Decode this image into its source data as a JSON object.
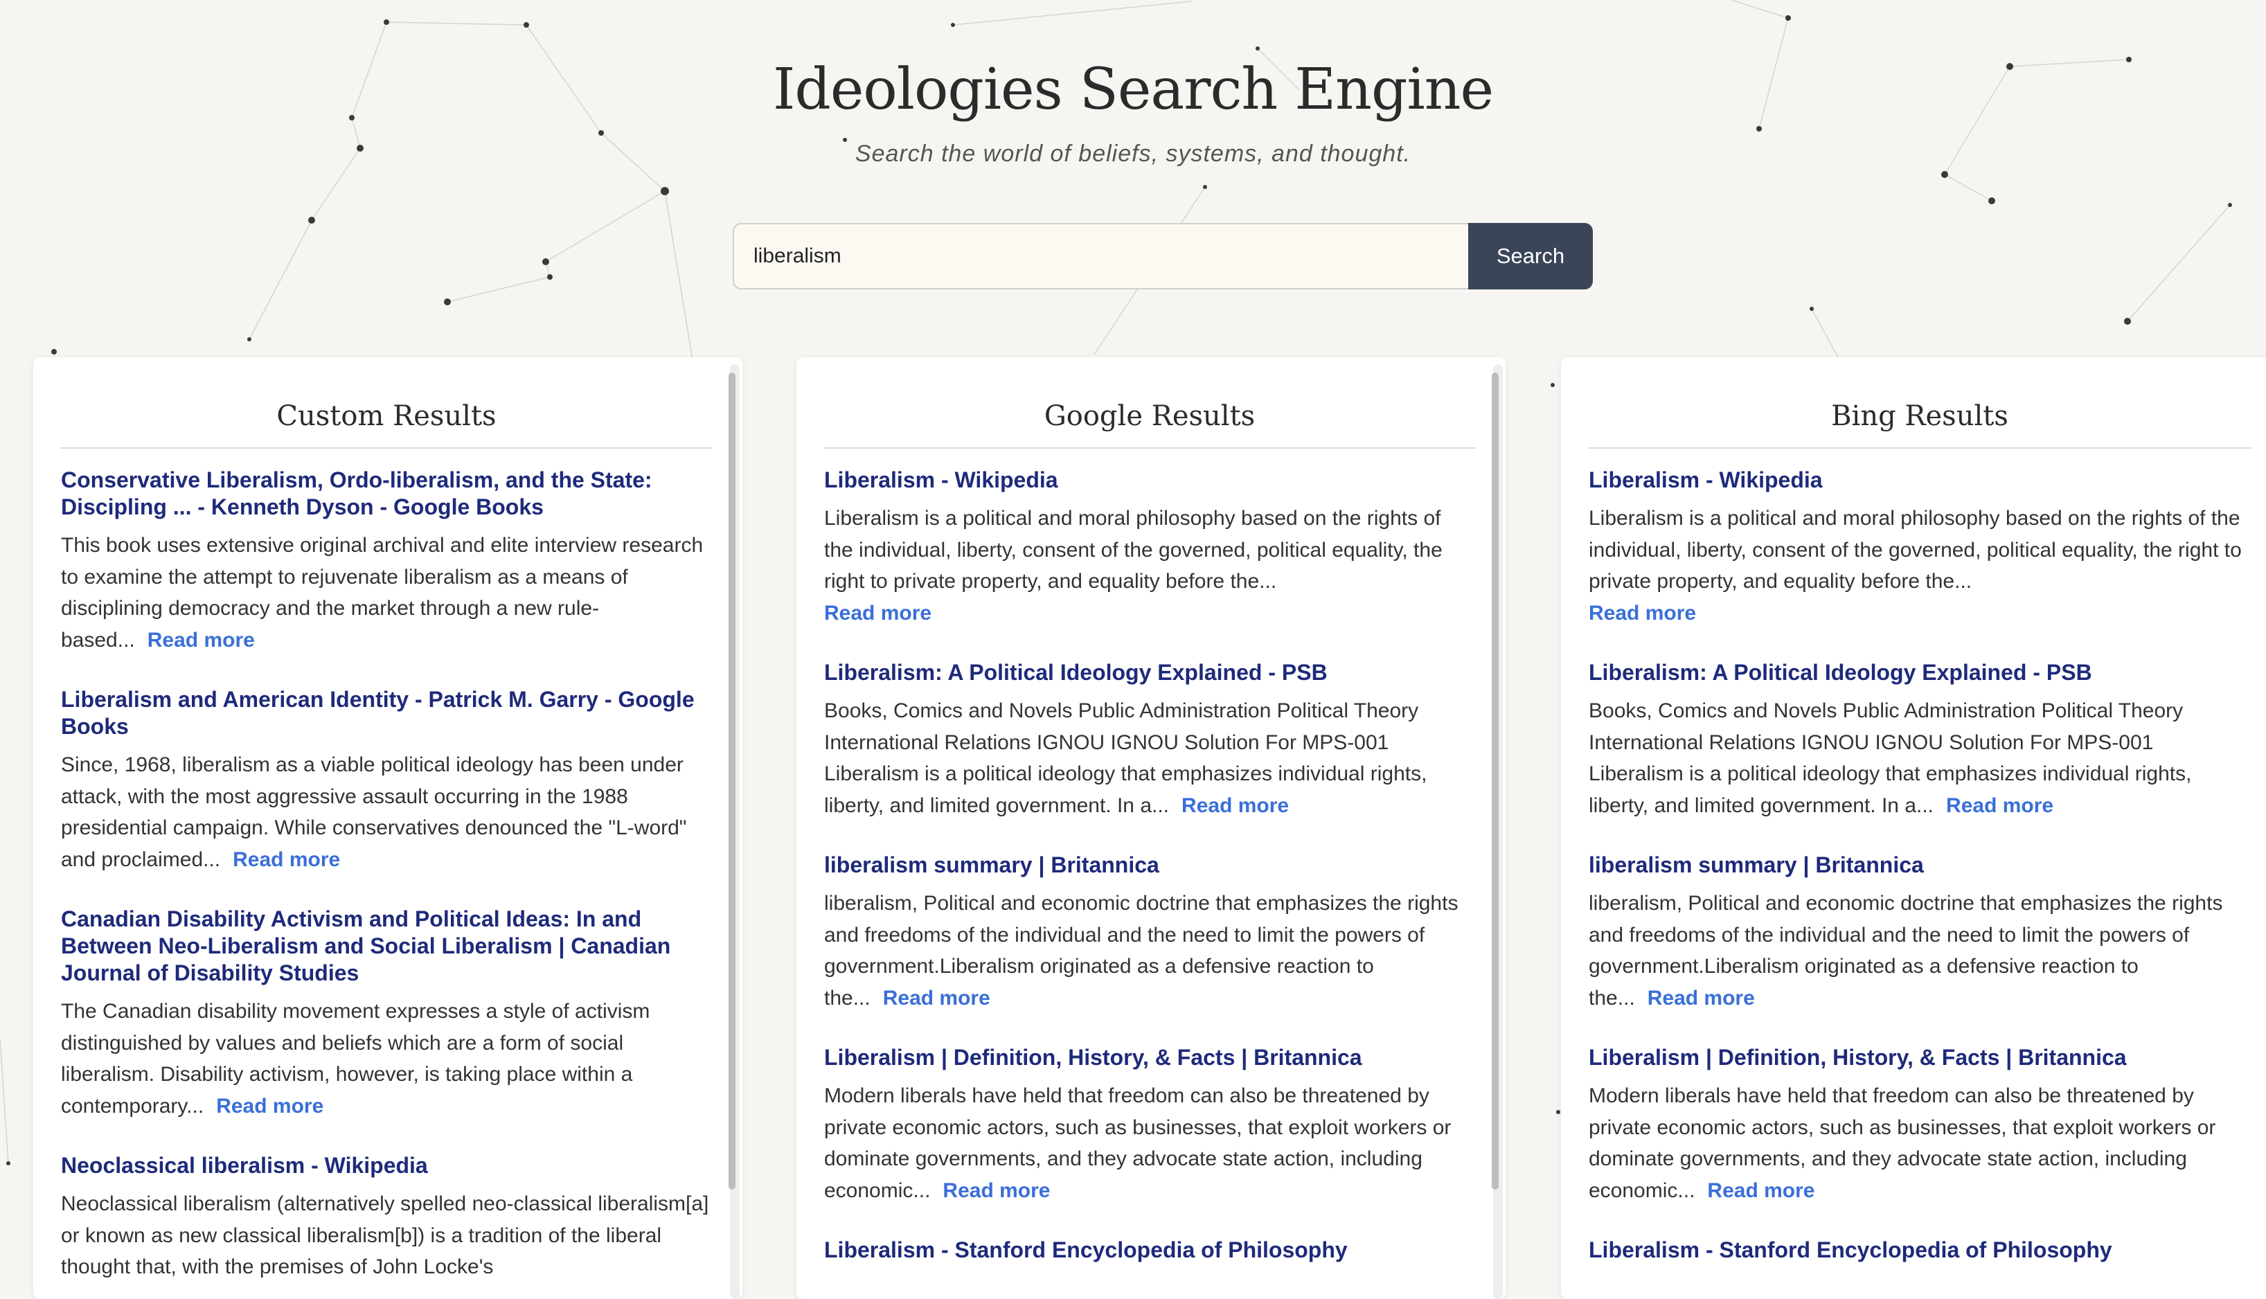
{
  "app": {
    "title": "Ideologies Search Engine",
    "subtitle": "Search the world of beliefs, systems, and thought."
  },
  "search": {
    "value": "liberalism",
    "button_label": "Search"
  },
  "read_more_label": "Read more",
  "panels": {
    "custom": {
      "title": "Custom Results",
      "results": [
        {
          "title": "Conservative Liberalism, Ordo-liberalism, and the State: Discipling ... - Kenneth Dyson - Google Books",
          "snippet": "This book uses extensive original archival and elite interview research to examine the attempt to rejuvenate liberalism as a means of disciplining democracy and the market through a new rule-based..."
        },
        {
          "title": "Liberalism and American Identity - Patrick M. Garry - Google Books",
          "snippet": "Since, 1968, liberalism as a viable political ideology has been under attack, with the most aggressive assault occurring in the 1988 presidential campaign. While conservatives denounced the \"L-word\" and proclaimed..."
        },
        {
          "title": "Canadian Disability Activism and Political Ideas: In and Between Neo-Liberalism and Social Liberalism | Canadian Journal of Disability Studies",
          "snippet": "The Canadian disability movement expresses a style of activism distinguished by values and beliefs which are a form of social liberalism. Disability activism, however, is taking place within a contemporary..."
        },
        {
          "title": "Neoclassical liberalism - Wikipedia",
          "snippet": "Neoclassical liberalism (alternatively spelled neo-classical liberalism[a] or known as new classical liberalism[b]) is a tradition of the liberal thought that, with the premises of John Locke's"
        }
      ]
    },
    "google": {
      "title": "Google Results",
      "results": [
        {
          "title": "Liberalism - Wikipedia",
          "snippet": "Liberalism is a political and moral philosophy based on the rights of the individual, liberty, consent of the governed, political equality, the right to private property, and equality before the..."
        },
        {
          "title": "Liberalism: A Political Ideology Explained - PSB",
          "snippet": "Books, Comics and Novels Public Administration Political Theory International Relations IGNOU IGNOU Solution For MPS-001 Liberalism is a political ideology that emphasizes individual rights, liberty, and limited government. In a..."
        },
        {
          "title": "liberalism summary | Britannica",
          "snippet": "liberalism, Political and economic doctrine that emphasizes the rights and freedoms of the individual and the need to limit the powers of government.Liberalism originated as a defensive reaction to the..."
        },
        {
          "title": "Liberalism | Definition, History, & Facts | Britannica",
          "snippet": "Modern liberals have held that freedom can also be threatened by private economic actors, such as businesses, that exploit workers or dominate governments, and they advocate state action, including economic..."
        },
        {
          "title": "Liberalism - Stanford Encyclopedia of Philosophy",
          "snippet": ""
        }
      ]
    },
    "bing": {
      "title": "Bing Results",
      "results": [
        {
          "title": "Liberalism - Wikipedia",
          "snippet": "Liberalism is a political and moral philosophy based on the rights of the individual, liberty, consent of the governed, political equality, the right to private property, and equality before the..."
        },
        {
          "title": "Liberalism: A Political Ideology Explained - PSB",
          "snippet": "Books, Comics and Novels Public Administration Political Theory International Relations IGNOU IGNOU Solution For MPS-001 Liberalism is a political ideology that emphasizes individual rights, liberty, and limited government. In a..."
        },
        {
          "title": "liberalism summary | Britannica",
          "snippet": "liberalism, Political and economic doctrine that emphasizes the rights and freedoms of the individual and the need to limit the powers of government.Liberalism originated as a defensive reaction to the..."
        },
        {
          "title": "Liberalism | Definition, History, & Facts | Britannica",
          "snippet": "Modern liberals have held that freedom can also be threatened by private economic actors, such as businesses, that exploit workers or dominate governments, and they advocate state action, including economic..."
        },
        {
          "title": "Liberalism - Stanford Encyclopedia of Philosophy",
          "snippet": ""
        }
      ]
    }
  },
  "colors": {
    "background": "#f6f5f2",
    "link_title": "#1e2a7a",
    "read_more": "#3a6fd8",
    "search_button": "#3a4658",
    "input_bg": "#fcf9f2"
  }
}
